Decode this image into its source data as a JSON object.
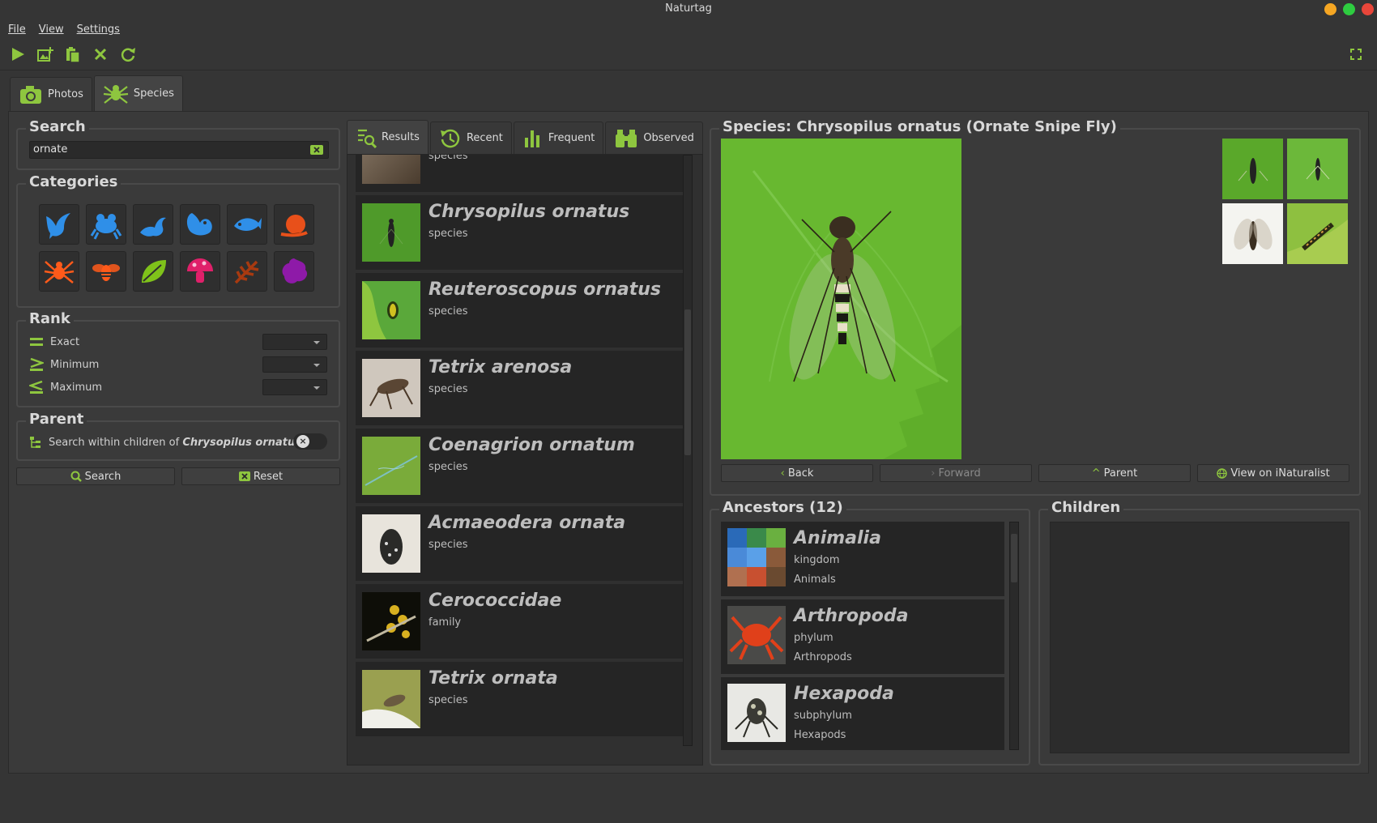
{
  "window": {
    "title": "Naturtag"
  },
  "menu": {
    "file": "File",
    "view": "View",
    "settings": "Settings"
  },
  "tabs": {
    "photos": "Photos",
    "species": "Species"
  },
  "search": {
    "title": "Search",
    "value": "ornate"
  },
  "categories": {
    "title": "Categories",
    "items": [
      {
        "name": "birds-icon",
        "color": "#2f8fe8"
      },
      {
        "name": "amphibians-icon",
        "color": "#2f8fe8"
      },
      {
        "name": "reptiles-icon",
        "color": "#2f8fe8"
      },
      {
        "name": "mammals-icon",
        "color": "#2f8fe8"
      },
      {
        "name": "fish-icon",
        "color": "#2f8fe8"
      },
      {
        "name": "mollusks-icon",
        "color": "#e8501a"
      },
      {
        "name": "arachnids-icon",
        "color": "#ff5a1a"
      },
      {
        "name": "insects-icon",
        "color": "#ff5a1a"
      },
      {
        "name": "plants-icon",
        "color": "#7fc21a"
      },
      {
        "name": "fungi-icon",
        "color": "#e0206a"
      },
      {
        "name": "protozoa-icon",
        "color": "#a83a10"
      },
      {
        "name": "chromista-icon",
        "color": "#8e1aa8"
      }
    ]
  },
  "rank": {
    "title": "Rank",
    "exact": "Exact",
    "minimum": "Minimum",
    "maximum": "Maximum"
  },
  "parent": {
    "title": "Parent",
    "label_prefix": "Search within children of ",
    "taxon": "Chrysopilus ornatus"
  },
  "buttons": {
    "search": "Search",
    "reset": "Reset",
    "back": "Back",
    "forward": "Forward",
    "parent": "Parent",
    "inat": "View on iNaturalist"
  },
  "result_tabs": {
    "results": "Results",
    "recent": "Recent",
    "frequent": "Frequent",
    "observed": "Observed"
  },
  "results": [
    {
      "name": "",
      "rank": "species",
      "thumb": "#6b5a48"
    },
    {
      "name": "Chrysopilus ornatus",
      "rank": "species",
      "thumb": "#4f9a2a"
    },
    {
      "name": "Reuteroscopus ornatus",
      "rank": "species",
      "thumb": "#5aa83a"
    },
    {
      "name": "Tetrix arenosa",
      "rank": "species",
      "thumb": "#8a7560"
    },
    {
      "name": "Coenagrion ornatum",
      "rank": "species",
      "thumb": "#7aab3a"
    },
    {
      "name": "Acmaeodera ornata",
      "rank": "species",
      "thumb": "#5a5a50"
    },
    {
      "name": "Cerococcidae",
      "rank": "family",
      "thumb": "#1a1a10"
    },
    {
      "name": "Tetrix ornata",
      "rank": "species",
      "thumb": "#9aa050"
    }
  ],
  "species": {
    "title": "Species: Chrysopilus ornatus (Ornate Snipe Fly)"
  },
  "ancestors": {
    "title": "Ancestors (12)",
    "items": [
      {
        "name": "Animalia",
        "rank": "kingdom",
        "common": "Animals"
      },
      {
        "name": "Arthropoda",
        "rank": "phylum",
        "common": "Arthropods"
      },
      {
        "name": "Hexapoda",
        "rank": "subphylum",
        "common": "Hexapods"
      }
    ]
  },
  "children": {
    "title": "Children"
  },
  "colors": {
    "accent": "#8ec63f",
    "bg": "#353535"
  }
}
